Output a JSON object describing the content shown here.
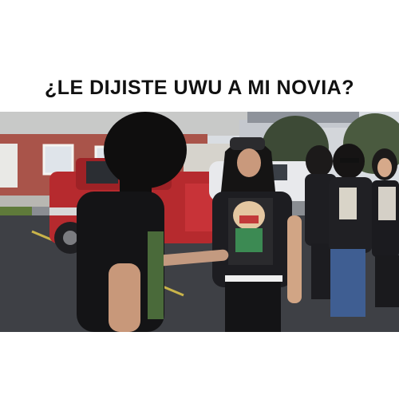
{
  "meme": {
    "caption": "¿LE DIJISTE UWU A MI NOVIA?",
    "background_color": "#ffffff",
    "text_color": "#111111"
  },
  "photo": {
    "description_icon": "street-scene-photo"
  }
}
